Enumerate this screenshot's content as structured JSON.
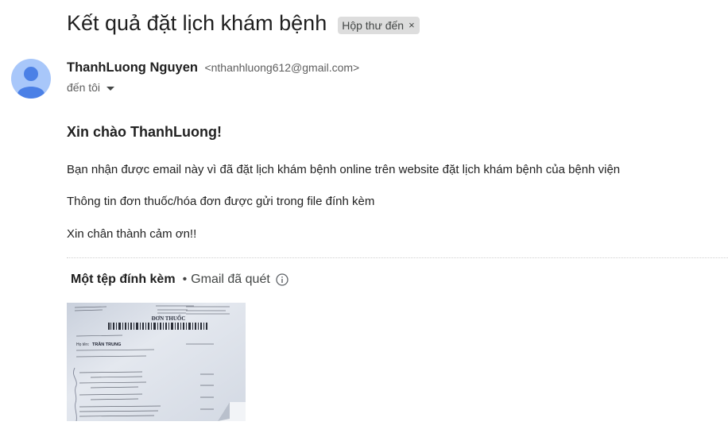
{
  "email": {
    "subject": "Kết quả đặt lịch khám bệnh",
    "label": "Hộp thư đến",
    "label_remove_glyph": "×",
    "sender_name": "ThanhLuong Nguyen",
    "sender_email": "<nthanhluong612@gmail.com>",
    "to_text": "đến tôi"
  },
  "body": {
    "greeting": "Xin chào ThanhLuong!",
    "paragraphs": [
      "Bạn nhận được email này vì đã đặt lịch khám bệnh online trên website đặt lịch khám bệnh của bệnh viện",
      "Thông tin đơn thuốc/hóa đơn được gửi trong file đính kèm",
      "Xin chân thành cảm ơn!!"
    ]
  },
  "attachments": {
    "title": "Một tệp đính kèm",
    "separator": "•",
    "scanned": "Gmail đã quét",
    "thumbnail": {
      "heading": "ĐƠN THUỐC",
      "patient_label": "Họ tên:",
      "patient_name": "TRẦN TRUNG"
    }
  },
  "colors": {
    "avatar_bg": "#a8c7fa",
    "avatar_fg": "#4b80e6",
    "chip_bg": "#dddddd"
  }
}
